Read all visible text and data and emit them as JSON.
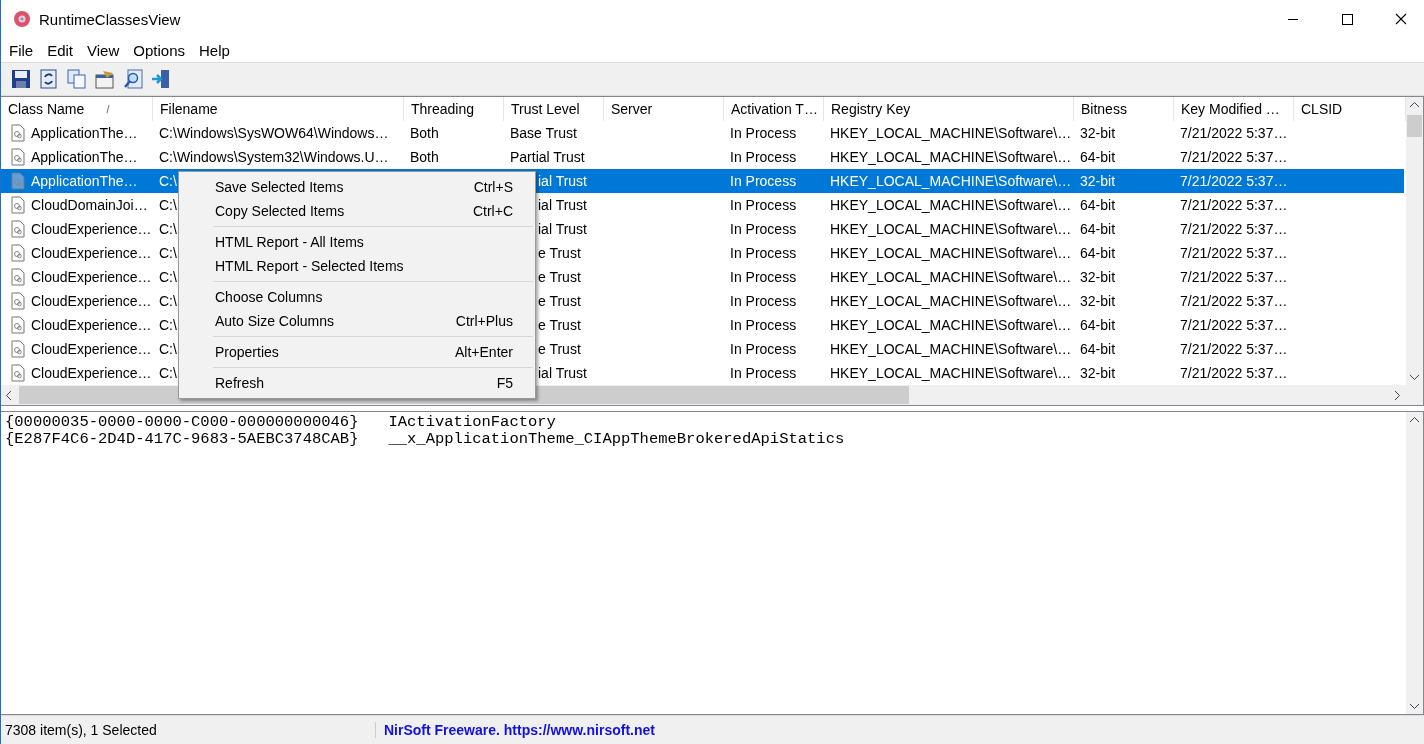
{
  "window": {
    "title": "RuntimeClassesView"
  },
  "menu_bar": [
    "File",
    "Edit",
    "View",
    "Options",
    "Help"
  ],
  "table": {
    "columns": [
      {
        "label": "Class Name",
        "sorted": true
      },
      {
        "label": "Filename",
        "sorted": false
      },
      {
        "label": "Threading",
        "sorted": false
      },
      {
        "label": "Trust Level",
        "sorted": false
      },
      {
        "label": "Server",
        "sorted": false
      },
      {
        "label": "Activation T…",
        "sorted": false
      },
      {
        "label": "Registry Key",
        "sorted": false
      },
      {
        "label": "Bitness",
        "sorted": false
      },
      {
        "label": "Key Modified …",
        "sorted": false
      },
      {
        "label": "CLSID",
        "sorted": false
      }
    ],
    "rows": [
      {
        "class_name": "ApplicationThe…",
        "filename": "C:\\Windows\\SysWOW64\\Windows…",
        "threading": "Both",
        "trust_level": "Base Trust",
        "activation_type": "In Process",
        "registry_key": "HKEY_LOCAL_MACHINE\\Software\\…",
        "bitness": "32-bit",
        "key_modified": "7/21/2022 5:37…",
        "selected": false,
        "covered": false
      },
      {
        "class_name": "ApplicationThe…",
        "filename": "C:\\Windows\\System32\\Windows.U…",
        "threading": "Both",
        "trust_level": "Partial Trust",
        "activation_type": "In Process",
        "registry_key": "HKEY_LOCAL_MACHINE\\Software\\…",
        "bitness": "64-bit",
        "key_modified": "7/21/2022 5:37…",
        "selected": false,
        "covered": false
      },
      {
        "class_name": "ApplicationThe…",
        "filename": "C:\\",
        "trust_level": "ial Trust",
        "activation_type": "In Process",
        "registry_key": "HKEY_LOCAL_MACHINE\\Software\\…",
        "bitness": "32-bit",
        "key_modified": "7/21/2022 5:37…",
        "selected": true,
        "covered": true
      },
      {
        "class_name": "CloudDomainJoi…",
        "filename": "C:\\",
        "trust_level": "ial Trust",
        "activation_type": "In Process",
        "registry_key": "HKEY_LOCAL_MACHINE\\Software\\…",
        "bitness": "64-bit",
        "key_modified": "7/21/2022 5:37…",
        "selected": false,
        "covered": true
      },
      {
        "class_name": "CloudExperience…",
        "filename": "C:\\",
        "trust_level": "ial Trust",
        "activation_type": "In Process",
        "registry_key": "HKEY_LOCAL_MACHINE\\Software\\…",
        "bitness": "64-bit",
        "key_modified": "7/21/2022 5:37…",
        "selected": false,
        "covered": true
      },
      {
        "class_name": "CloudExperience…",
        "filename": "C:\\",
        "trust_level": "e Trust",
        "activation_type": "In Process",
        "registry_key": "HKEY_LOCAL_MACHINE\\Software\\…",
        "bitness": "64-bit",
        "key_modified": "7/21/2022 5:37…",
        "selected": false,
        "covered": true
      },
      {
        "class_name": "CloudExperience…",
        "filename": "C:\\",
        "trust_level": "e Trust",
        "activation_type": "In Process",
        "registry_key": "HKEY_LOCAL_MACHINE\\Software\\…",
        "bitness": "32-bit",
        "key_modified": "7/21/2022 5:37…",
        "selected": false,
        "covered": true
      },
      {
        "class_name": "CloudExperience…",
        "filename": "C:\\",
        "trust_level": "e Trust",
        "activation_type": "In Process",
        "registry_key": "HKEY_LOCAL_MACHINE\\Software\\…",
        "bitness": "32-bit",
        "key_modified": "7/21/2022 5:37…",
        "selected": false,
        "covered": true
      },
      {
        "class_name": "CloudExperience…",
        "filename": "C:\\",
        "trust_level": "e Trust",
        "activation_type": "In Process",
        "registry_key": "HKEY_LOCAL_MACHINE\\Software\\…",
        "bitness": "64-bit",
        "key_modified": "7/21/2022 5:37…",
        "selected": false,
        "covered": true
      },
      {
        "class_name": "CloudExperience…",
        "filename": "C:\\",
        "trust_level": "e Trust",
        "activation_type": "In Process",
        "registry_key": "HKEY_LOCAL_MACHINE\\Software\\…",
        "bitness": "64-bit",
        "key_modified": "7/21/2022 5:37…",
        "selected": false,
        "covered": true
      },
      {
        "class_name": "CloudExperience…",
        "filename": "C:\\",
        "trust_level": "ial Trust",
        "activation_type": "In Process",
        "registry_key": "HKEY_LOCAL_MACHINE\\Software\\…",
        "bitness": "32-bit",
        "key_modified": "7/21/2022 5:37…",
        "selected": false,
        "covered": true
      }
    ]
  },
  "context_menu": [
    {
      "kind": "item",
      "label": "Save Selected Items",
      "shortcut": "Ctrl+S"
    },
    {
      "kind": "item",
      "label": "Copy Selected Items",
      "shortcut": "Ctrl+C"
    },
    {
      "kind": "separator"
    },
    {
      "kind": "item",
      "label": "HTML Report - All Items"
    },
    {
      "kind": "item",
      "label": "HTML Report - Selected Items"
    },
    {
      "kind": "separator"
    },
    {
      "kind": "item",
      "label": "Choose Columns"
    },
    {
      "kind": "item",
      "label": "Auto Size Columns",
      "shortcut": "Ctrl+Plus"
    },
    {
      "kind": "separator"
    },
    {
      "kind": "item",
      "label": "Properties",
      "shortcut": "Alt+Enter"
    },
    {
      "kind": "separator"
    },
    {
      "kind": "item",
      "label": "Refresh",
      "shortcut": "F5"
    }
  ],
  "details": [
    {
      "guid": "{00000035-0000-0000-C000-000000000046}",
      "name": "IActivationFactory"
    },
    {
      "guid": "{E287F4C6-2D4D-417C-9683-5AEBC3748CAB}",
      "name": "__x_ApplicationTheme_CIAppThemeBrokeredApiStatics"
    }
  ],
  "status_bar": {
    "count": "7308 item(s), 1 Selected",
    "link": "NirSoft Freeware. https://www.nirsoft.net"
  }
}
